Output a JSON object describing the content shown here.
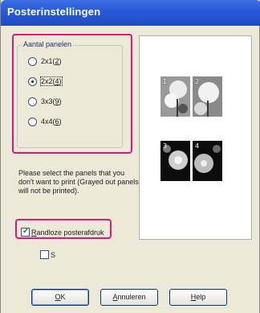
{
  "window": {
    "title": "Posterinstellingen"
  },
  "panel_group": {
    "label": "Aantal panelen",
    "options": [
      {
        "text": "2x1",
        "mnemonic": "2",
        "selected": false
      },
      {
        "text": "2x2",
        "mnemonic": "4",
        "selected": true
      },
      {
        "text": "3x3",
        "mnemonic": "9",
        "selected": false
      },
      {
        "text": "4x4",
        "mnemonic": "6",
        "selected": false
      }
    ]
  },
  "instructions": "Please select the panels that you don't want to print (Grayed out panels will not be printed).",
  "preview": {
    "panels": [
      "1",
      "2",
      "3",
      "4"
    ]
  },
  "borderless": {
    "label_mnemonic": "R",
    "label_rest": "andloze posterafdruk",
    "checked": true
  },
  "second_option": {
    "label": "S",
    "checked": false
  },
  "buttons": {
    "ok": {
      "mnemonic": "O",
      "rest": "K"
    },
    "cancel": {
      "mnemonic": "A",
      "rest": "nnuleren"
    },
    "help": {
      "mnemonic": "H",
      "rest": "elp"
    }
  },
  "colors": {
    "highlight": "#e0167c",
    "titlebar": "#2a5bd7",
    "dialog_bg": "#ece9d8"
  }
}
